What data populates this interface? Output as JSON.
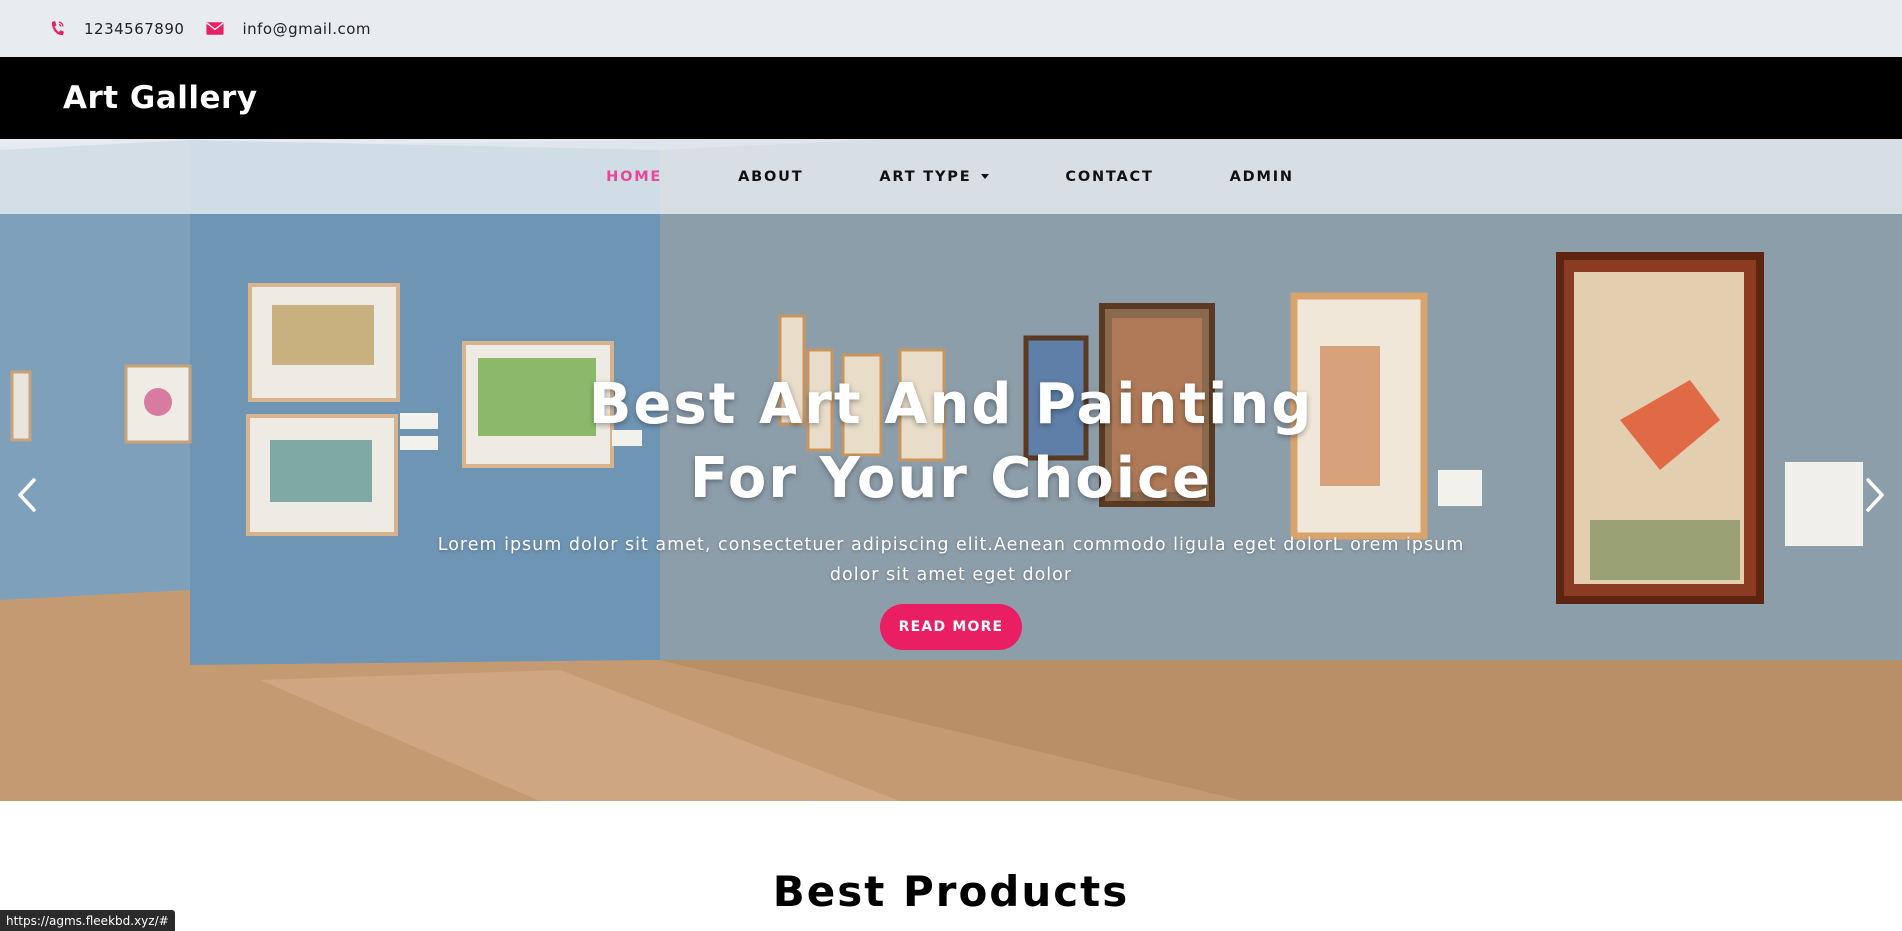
{
  "topbar": {
    "phone": "1234567890",
    "email": "info@gmail.com",
    "icon_color": "#e91e63"
  },
  "brand": {
    "name": "Art Gallery"
  },
  "nav": {
    "items": [
      {
        "label": "HOME"
      },
      {
        "label": "ABOUT"
      },
      {
        "label": "ART TYPE"
      },
      {
        "label": "CONTACT"
      },
      {
        "label": "ADMIN"
      }
    ],
    "active_color": "#e8479c"
  },
  "hero": {
    "title_line1": "Best Art And Painting",
    "title_line2": "For Your Choice",
    "subtitle": "Lorem ipsum dolor sit amet, consectetuer adipiscing elit.Aenean commodo ligula eget dolorL orem ipsum dolor sit amet eget dolor",
    "button_label": "READ MORE",
    "button_color": "#e91e63"
  },
  "section": {
    "products_title": "Best Products"
  },
  "status": {
    "url": "https://agms.fleekbd.xyz/#"
  }
}
